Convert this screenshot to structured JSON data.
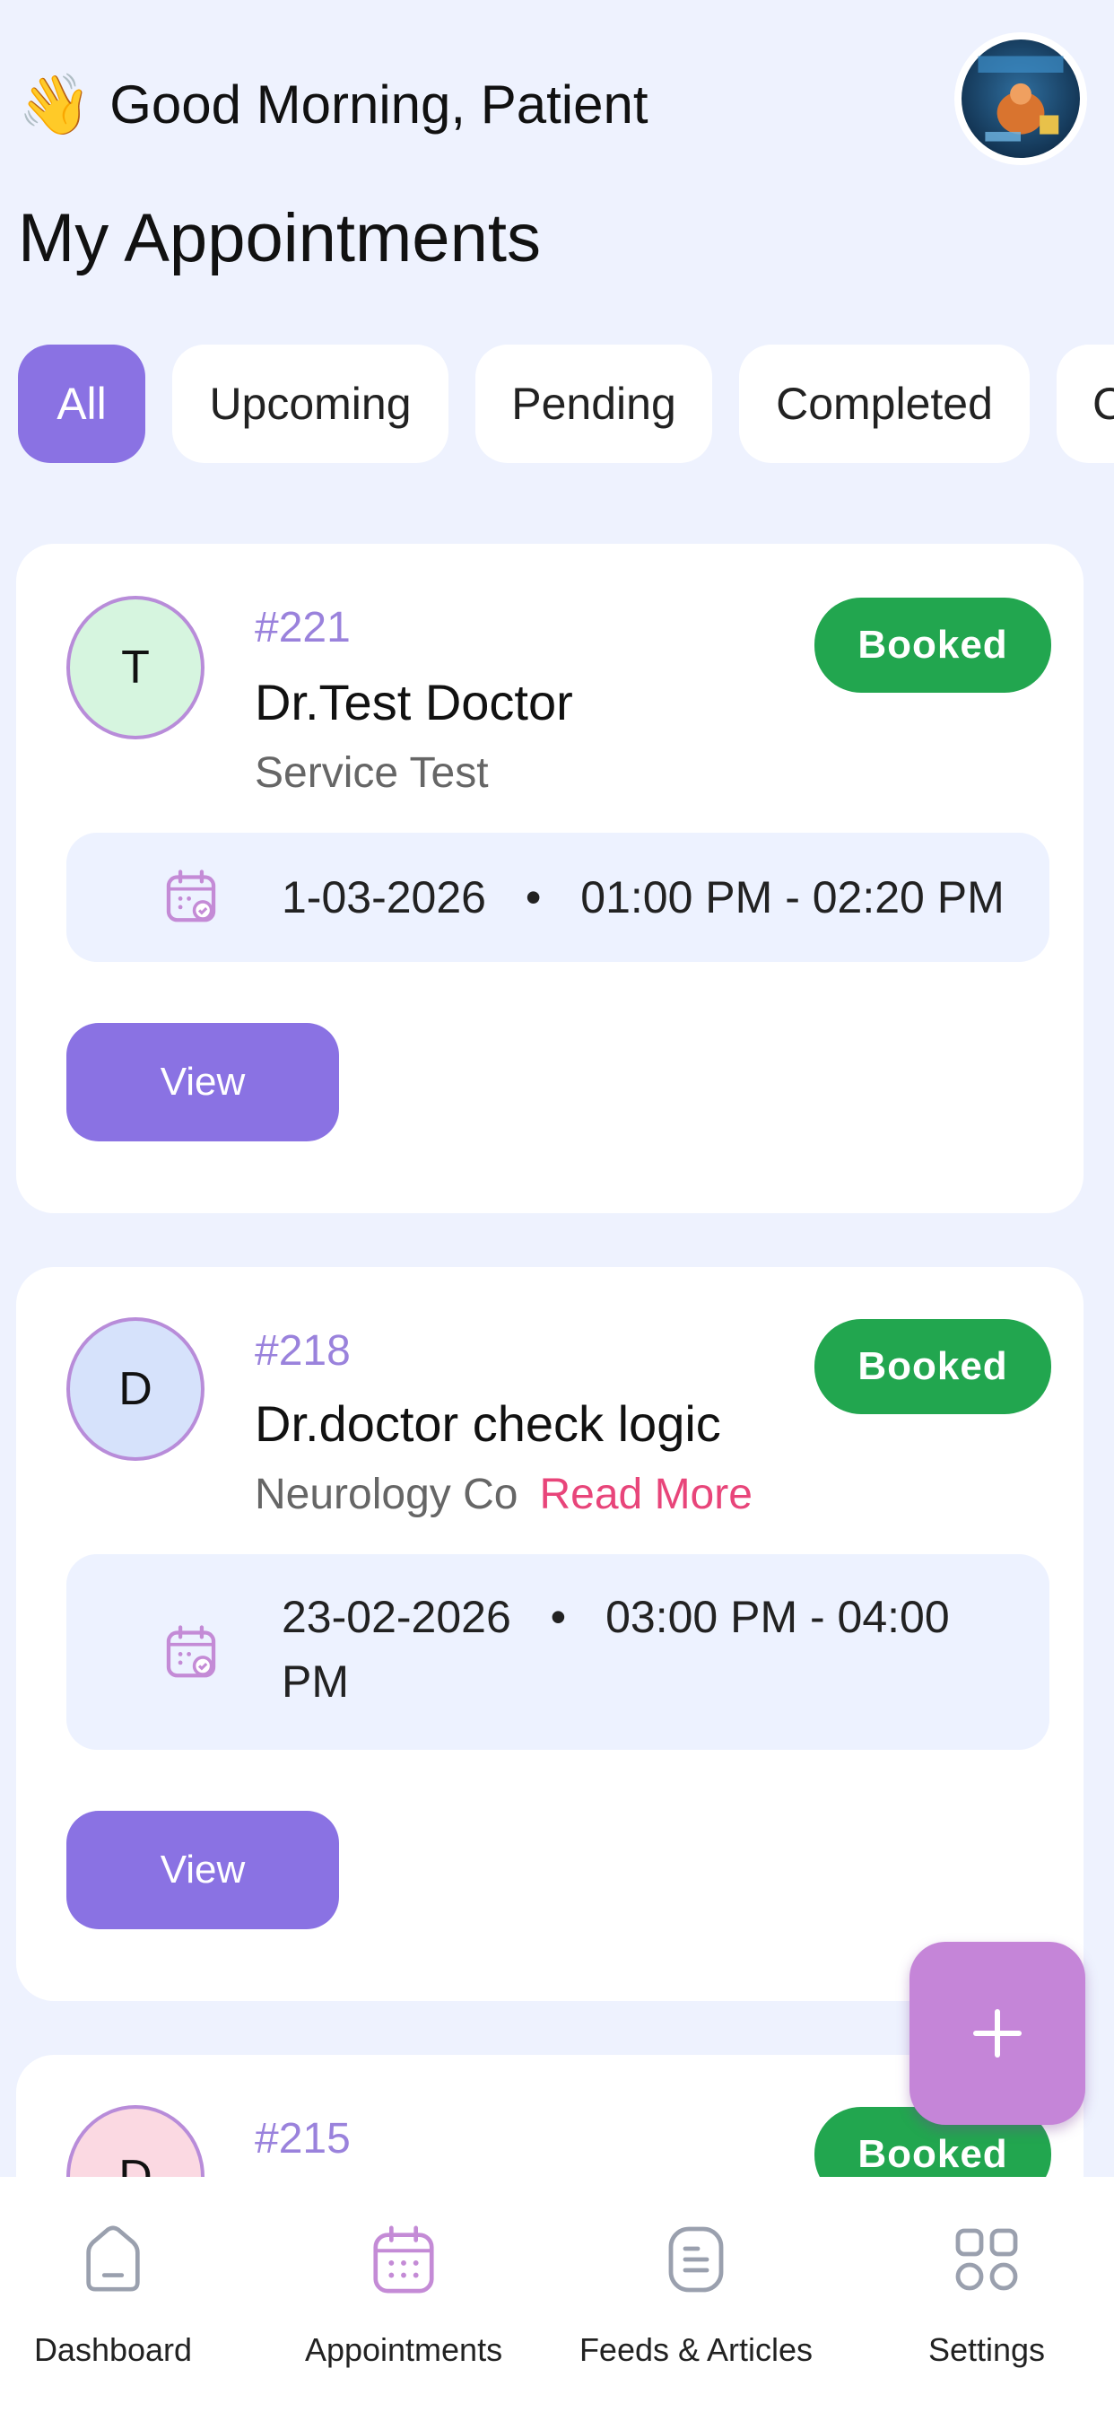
{
  "header": {
    "wave_icon": "👋",
    "greeting": "Good Morning, Patient",
    "title": "My Appointments",
    "profile_avatar": "profile-photo"
  },
  "tabs": [
    {
      "label": "All",
      "active": true
    },
    {
      "label": "Upcoming",
      "active": false
    },
    {
      "label": "Pending",
      "active": false
    },
    {
      "label": "Completed",
      "active": false
    },
    {
      "label": "C",
      "active": false
    }
  ],
  "appointments": [
    {
      "initial": "T",
      "avatar_color": "#d6f5df",
      "id": "#221",
      "doctor": "Dr.Test Doctor",
      "service": "Service Test",
      "read_more": "",
      "status": "Booked",
      "date": "1-03-2026",
      "separator": "•",
      "time": "01:00 PM - 02:20 PM",
      "view_label": "View"
    },
    {
      "initial": "D",
      "avatar_color": "#d6e2fb",
      "id": "#218",
      "doctor": "Dr.doctor check logic",
      "service": "Neurology Co",
      "read_more": "Read More",
      "status": "Booked",
      "date": "23-02-2026",
      "separator": "•",
      "time": "03:00 PM - 04:00",
      "time_cont": "PM",
      "view_label": "View"
    },
    {
      "initial": "D",
      "avatar_color": "#fbd9e2",
      "id": "#215",
      "status": "Booked"
    }
  ],
  "fab": {
    "icon": "plus-icon"
  },
  "bottom_nav": [
    {
      "label": "Dashboard",
      "icon": "home-icon",
      "active": false
    },
    {
      "label": "Appointments",
      "icon": "calendar-icon",
      "active": true
    },
    {
      "label": "Feeds & Articles",
      "icon": "document-icon",
      "active": false
    },
    {
      "label": "Settings",
      "icon": "grid-icon",
      "active": false
    }
  ],
  "colors": {
    "primary": "#8a72e3",
    "booked": "#22a64f",
    "read_more": "#e8457a",
    "fab": "#c585d8",
    "background": "#eef2fe"
  }
}
